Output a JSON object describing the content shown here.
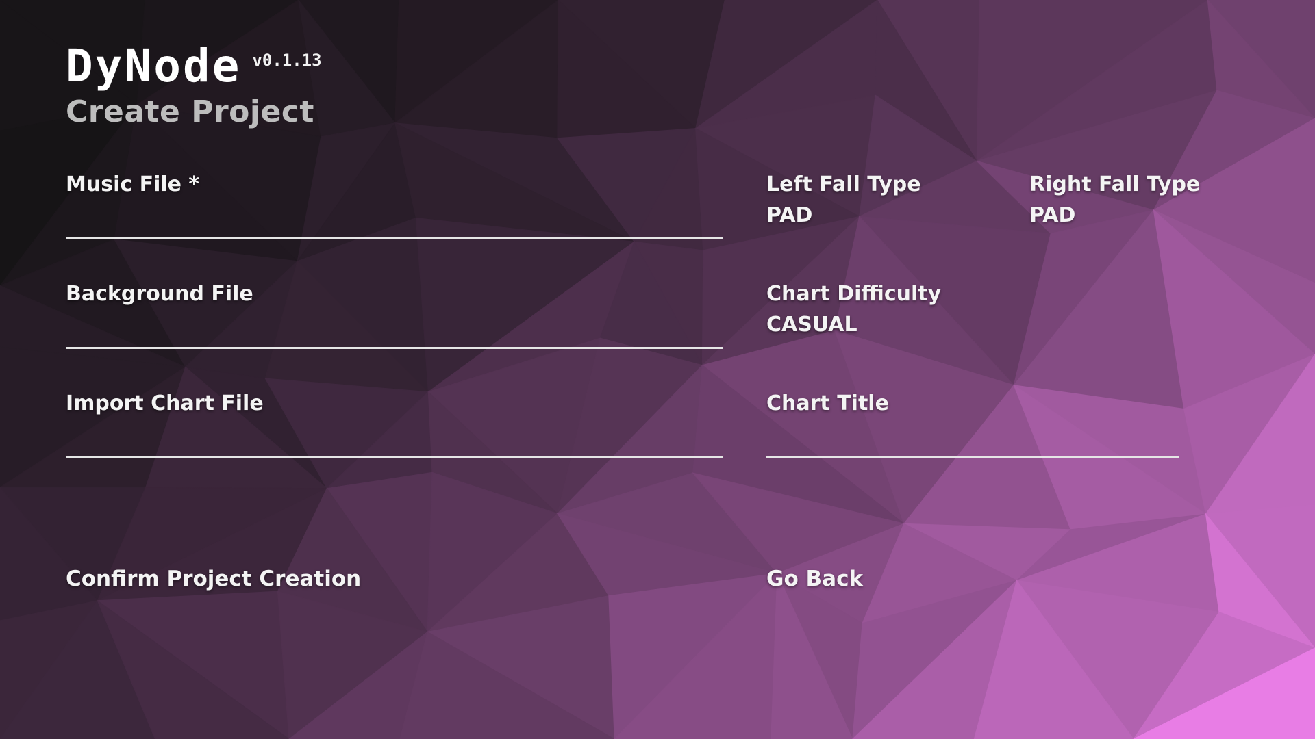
{
  "app": {
    "name": "DyNode",
    "version": "v0.1.13"
  },
  "page": {
    "title": "Create Project"
  },
  "form": {
    "music_file": {
      "label": "Music File *",
      "value": ""
    },
    "background_file": {
      "label": "Background File",
      "value": ""
    },
    "import_chart_file": {
      "label": "Import Chart File",
      "value": ""
    },
    "left_fall_type": {
      "label": "Left Fall Type",
      "value": "PAD"
    },
    "right_fall_type": {
      "label": "Right Fall Type",
      "value": "PAD"
    },
    "chart_difficulty": {
      "label": "Chart Difficulty",
      "value": "CASUAL"
    },
    "chart_title": {
      "label": "Chart Title",
      "value": ""
    }
  },
  "actions": {
    "confirm": "Confirm Project Creation",
    "go_back": "Go Back"
  },
  "colors": {
    "background_dark": "#151315",
    "background_accent": "#e97ee6",
    "text": "#ffffff",
    "subtitle": "#bdbdbd",
    "underline": "#e6e6e6"
  }
}
